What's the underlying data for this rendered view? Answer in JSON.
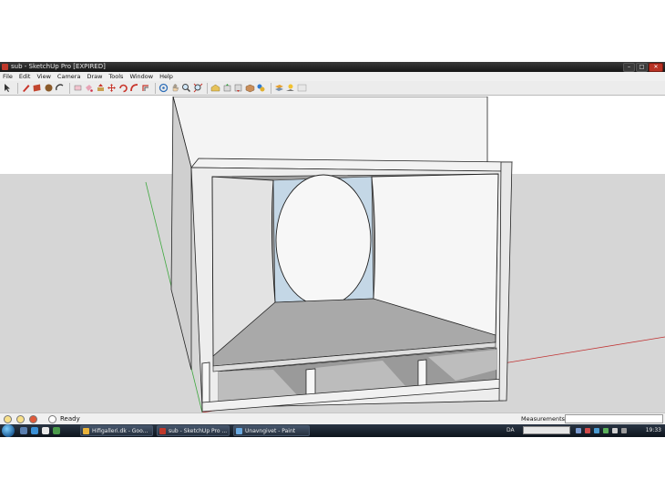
{
  "window": {
    "title": "sub - SketchUp Pro [EXPIRED]",
    "controls": {
      "minimize": "–",
      "maximize": "□",
      "close": "✕"
    }
  },
  "menu": [
    "File",
    "Edit",
    "View",
    "Camera",
    "Draw",
    "Tools",
    "Window",
    "Help"
  ],
  "toolbar_icons": [
    "select-arrow-icon",
    "pencil-line-icon",
    "rectangle-icon",
    "circle-icon",
    "arc-icon",
    "eraser-icon",
    "paint-bucket-icon",
    "push-pull-icon",
    "move-icon",
    "rotate-icon",
    "follow-me-icon",
    "offset-icon",
    "orbit-icon",
    "pan-hand-icon",
    "zoom-icon",
    "zoom-extents-icon",
    "3d-warehouse-icon",
    "share-model-icon",
    "get-models-icon",
    "components-icon",
    "styles-icon",
    "section-plane-icon",
    "shadows-icon",
    "fog-icon"
  ],
  "status": {
    "text": "Ready",
    "measurements_label": "Measurements"
  },
  "taskbar": {
    "buttons": [
      {
        "label": "Hifigalleri.dk - Goo...",
        "icon": "chrome-icon",
        "color": "#e8b23a"
      },
      {
        "label": "sub - SketchUp Pro ...",
        "icon": "sketchup-icon",
        "color": "#c0392b"
      },
      {
        "label": "Unavngivet - Paint",
        "icon": "paint-icon",
        "color": "#6aa9e0"
      }
    ],
    "language": "DA",
    "clock": "19:33"
  },
  "colors": {
    "sky": "#ffffff",
    "ground": "#d6d6d6",
    "titlebar": "#1f1f1f",
    "axis_green": "#3ea83e",
    "axis_red": "#c03030"
  }
}
